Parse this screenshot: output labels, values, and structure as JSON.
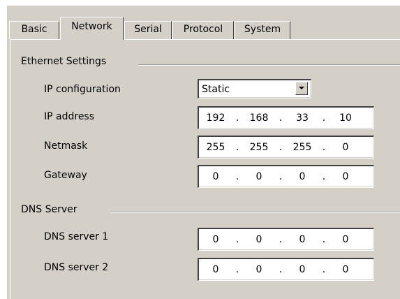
{
  "tabs": [
    {
      "label": "Basic"
    },
    {
      "label": "Network",
      "active": true
    },
    {
      "label": "Serial"
    },
    {
      "label": "Protocol"
    },
    {
      "label": "System"
    }
  ],
  "ethernet": {
    "title": "Ethernet Settings",
    "ip_configuration": {
      "label": "IP configuration",
      "value": "Static",
      "icon": "chevron-down-icon"
    },
    "ip_address": {
      "label": "IP address",
      "octets": [
        "192",
        "168",
        "33",
        "10"
      ]
    },
    "netmask": {
      "label": "Netmask",
      "octets": [
        "255",
        "255",
        "255",
        "0"
      ]
    },
    "gateway": {
      "label": "Gateway",
      "octets": [
        "0",
        "0",
        "0",
        "0"
      ]
    }
  },
  "dns": {
    "title": "DNS Server",
    "server1": {
      "label": "DNS server 1",
      "octets": [
        "0",
        "0",
        "0",
        "0"
      ]
    },
    "server2": {
      "label": "DNS server 2",
      "octets": [
        "0",
        "0",
        "0",
        "0"
      ]
    }
  },
  "separator": "."
}
